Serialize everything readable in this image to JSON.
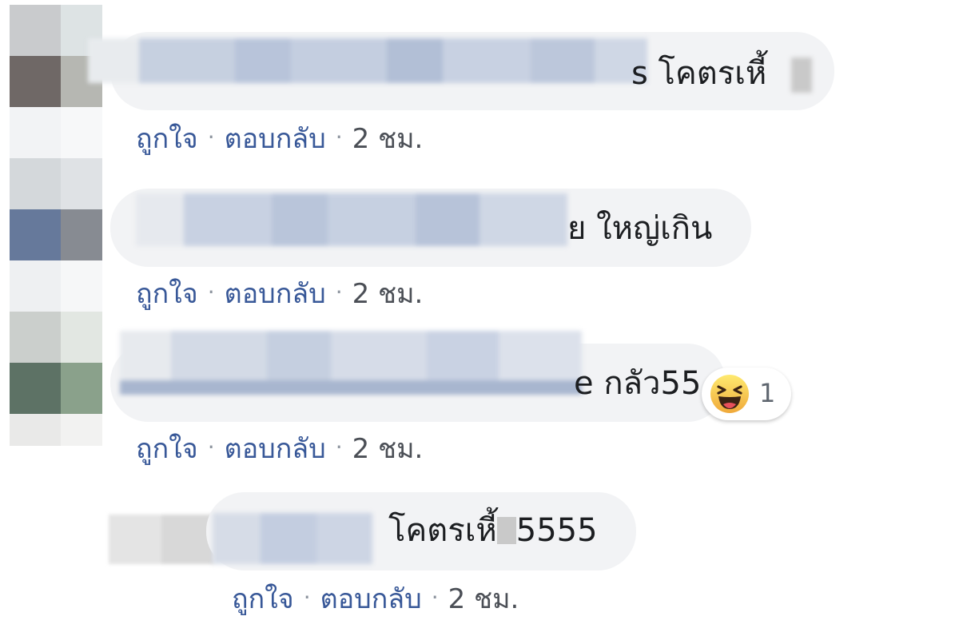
{
  "comments": [
    {
      "visible_text": "s โคตรเหี้",
      "actions": {
        "like": "ถูกใจ",
        "reply": "ตอบกลับ",
        "time": "2 ชม."
      }
    },
    {
      "visible_text": "ย ใหญ่เกิน",
      "actions": {
        "like": "ถูกใจ",
        "reply": "ตอบกลับ",
        "time": "2 ชม."
      }
    },
    {
      "visible_text": "e กลัว55",
      "reaction": {
        "icon": "laughing-emoji-icon",
        "count": "1"
      },
      "actions": {
        "like": "ถูกใจ",
        "reply": "ตอบกลับ",
        "time": "2 ชม."
      }
    },
    {
      "visible_text": "โคตรเหี้",
      "visible_text_2": "5555",
      "actions": {
        "like": "ถูกใจ",
        "reply": "ตอบกลับ",
        "time": "2 ชม."
      }
    }
  ],
  "separator": "·",
  "colors": {
    "bubble_bg": "#f2f3f5",
    "link_blue": "#385898",
    "text_dark": "#1c1e21",
    "meta_gray": "#4b4f56"
  }
}
